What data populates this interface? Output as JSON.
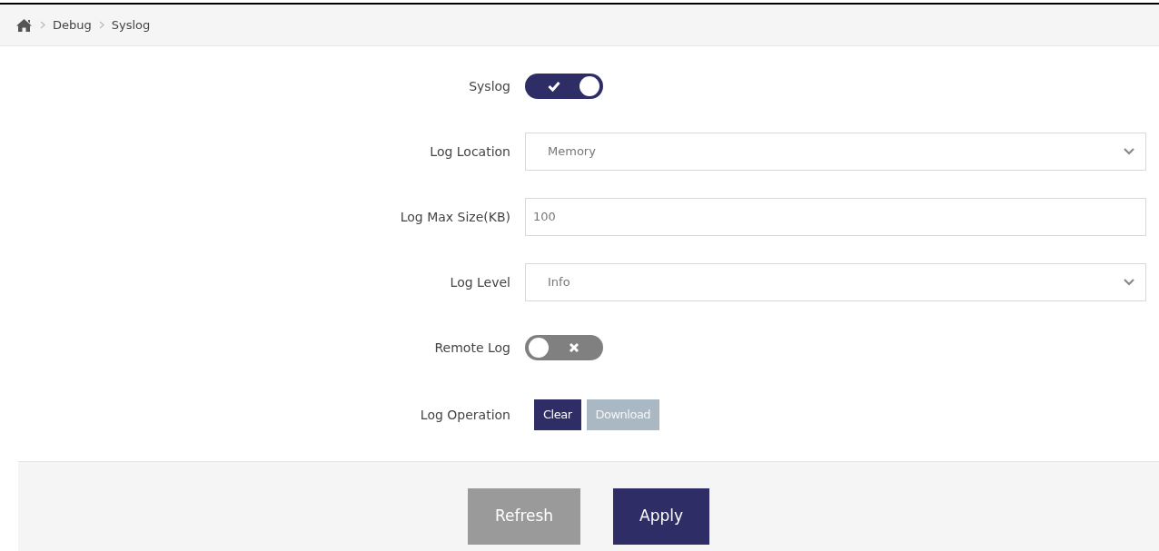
{
  "breadcrumb": [
    "Debug",
    "Syslog"
  ],
  "fields": [
    {
      "kind": "toggle",
      "label": "Syslog",
      "on": true
    },
    {
      "kind": "select",
      "label": "Log Location",
      "value": "Memory"
    },
    {
      "kind": "input",
      "label": "Log Max Size(KB)",
      "value": "100"
    },
    {
      "kind": "select",
      "label": "Log Level",
      "value": "Info"
    },
    {
      "kind": "toggle",
      "label": "Remote Log",
      "on": false
    },
    {
      "kind": "buttons",
      "label": "Log Operation",
      "buttons": [
        {
          "label": "Clear",
          "disabled": false
        },
        {
          "label": "Download",
          "disabled": true
        }
      ]
    }
  ],
  "footer_buttons": [
    {
      "label": "Refresh",
      "kind": "secondary"
    },
    {
      "label": "Apply",
      "kind": "primary"
    }
  ]
}
